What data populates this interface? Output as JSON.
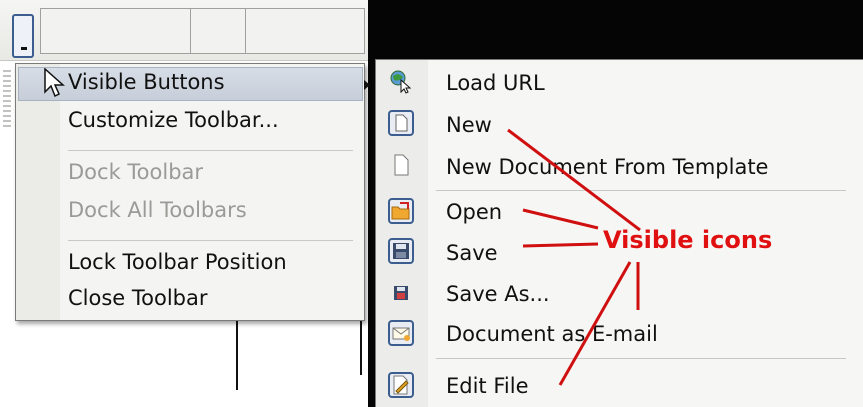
{
  "context_menu": {
    "items": [
      {
        "label": "Visible Buttons",
        "enabled": true,
        "has_submenu": true,
        "highlighted": true
      },
      {
        "label": "Customize Toolbar...",
        "enabled": true
      },
      {
        "label": "Dock Toolbar",
        "enabled": false
      },
      {
        "label": "Dock All Toolbars",
        "enabled": false
      },
      {
        "label": "Lock Toolbar Position",
        "enabled": true
      },
      {
        "label": "Close Toolbar",
        "enabled": true
      }
    ]
  },
  "submenu": {
    "items": [
      {
        "label": "Load URL",
        "icon": "globe-cursor-icon"
      },
      {
        "label": "New",
        "icon": "new-document-icon",
        "checked": true
      },
      {
        "label": "New Document From Template",
        "icon": "template-document-icon"
      },
      {
        "label": "Open",
        "icon": "open-folder-icon",
        "checked": true
      },
      {
        "label": "Save",
        "icon": "save-floppy-icon",
        "checked": true
      },
      {
        "label": "Save As...",
        "icon": "save-as-icon"
      },
      {
        "label": "Document as E-mail",
        "icon": "email-document-icon",
        "checked": true
      },
      {
        "label": "Edit File",
        "icon": "edit-file-icon",
        "checked": true
      }
    ]
  },
  "annotation": {
    "text": "Visible icons",
    "color": "#e01010"
  }
}
